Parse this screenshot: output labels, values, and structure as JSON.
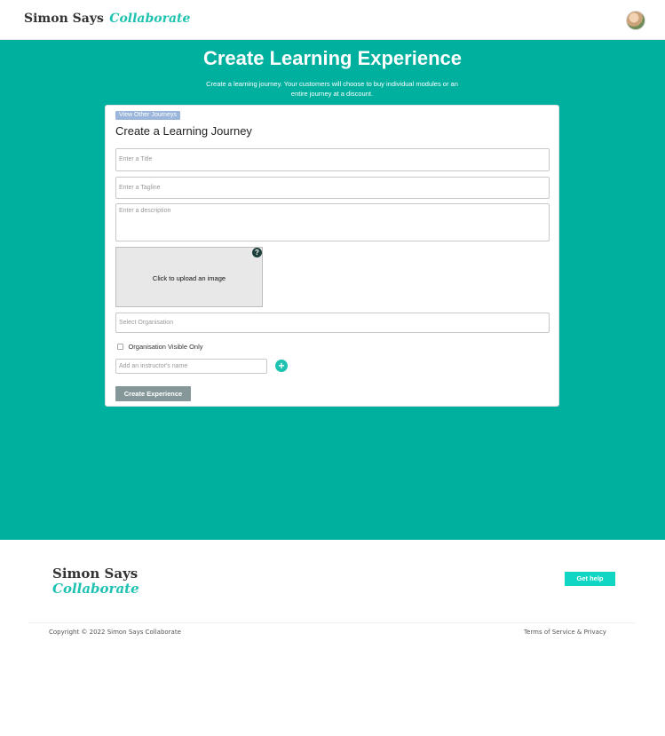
{
  "header": {
    "brand_primary": "Simon Says",
    "brand_secondary": "Collaborate"
  },
  "hero": {
    "title": "Create Learning Experience",
    "subtitle": "Create a learning journey. Your customers will choose to buy individual modules or an entire journey at a discount."
  },
  "form": {
    "view_others_label": "View Other Journeys",
    "title": "Create a Learning Journey",
    "title_placeholder": "Enter a Title",
    "tagline_placeholder": "Enter a Tagline",
    "description_placeholder": "Enter a description",
    "upload_label": "Click to upload an image",
    "help_icon": "?",
    "organisation_placeholder": "Select Organisation",
    "visibility_label": "Organisation Visible Only",
    "visibility_checked": false,
    "instructor_placeholder": "Add an instructor's name",
    "add_instructor_icon": "+",
    "submit_label": "Create Experience"
  },
  "footer": {
    "brand_primary": "Simon Says",
    "brand_secondary": "Collaborate",
    "help_label": "Get help",
    "copyright": "Copyright © 2022 Simon Says Collaborate",
    "terms": "Terms of Service & Privacy"
  },
  "colors": {
    "accent": "#00b09e",
    "brand_teal": "#1fc2b0",
    "button_grey": "#86979a",
    "tag_blue": "#9bb6da"
  }
}
